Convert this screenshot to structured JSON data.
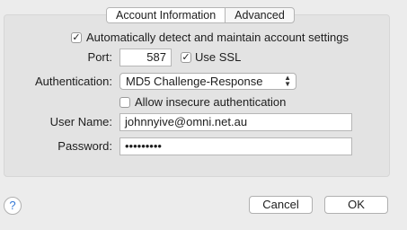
{
  "tabs": [
    {
      "label": "Account Information"
    },
    {
      "label": "Advanced"
    }
  ],
  "auto_detect": {
    "label": "Automatically detect and maintain account settings",
    "checked": true
  },
  "port": {
    "label": "Port:",
    "value": "587"
  },
  "use_ssl": {
    "label": "Use SSL",
    "checked": true
  },
  "authentication": {
    "label": "Authentication:",
    "value": "MD5 Challenge-Response"
  },
  "allow_insecure": {
    "label": "Allow insecure authentication",
    "checked": false
  },
  "user_name": {
    "label": "User Name:",
    "value": "johnnyive@omni.net.au"
  },
  "password": {
    "label": "Password:",
    "value": "•••••••••"
  },
  "buttons": {
    "help": "?",
    "cancel": "Cancel",
    "ok": "OK"
  },
  "icons": {
    "check": "✓",
    "select_arrows": "up-down-chevron-icon"
  }
}
